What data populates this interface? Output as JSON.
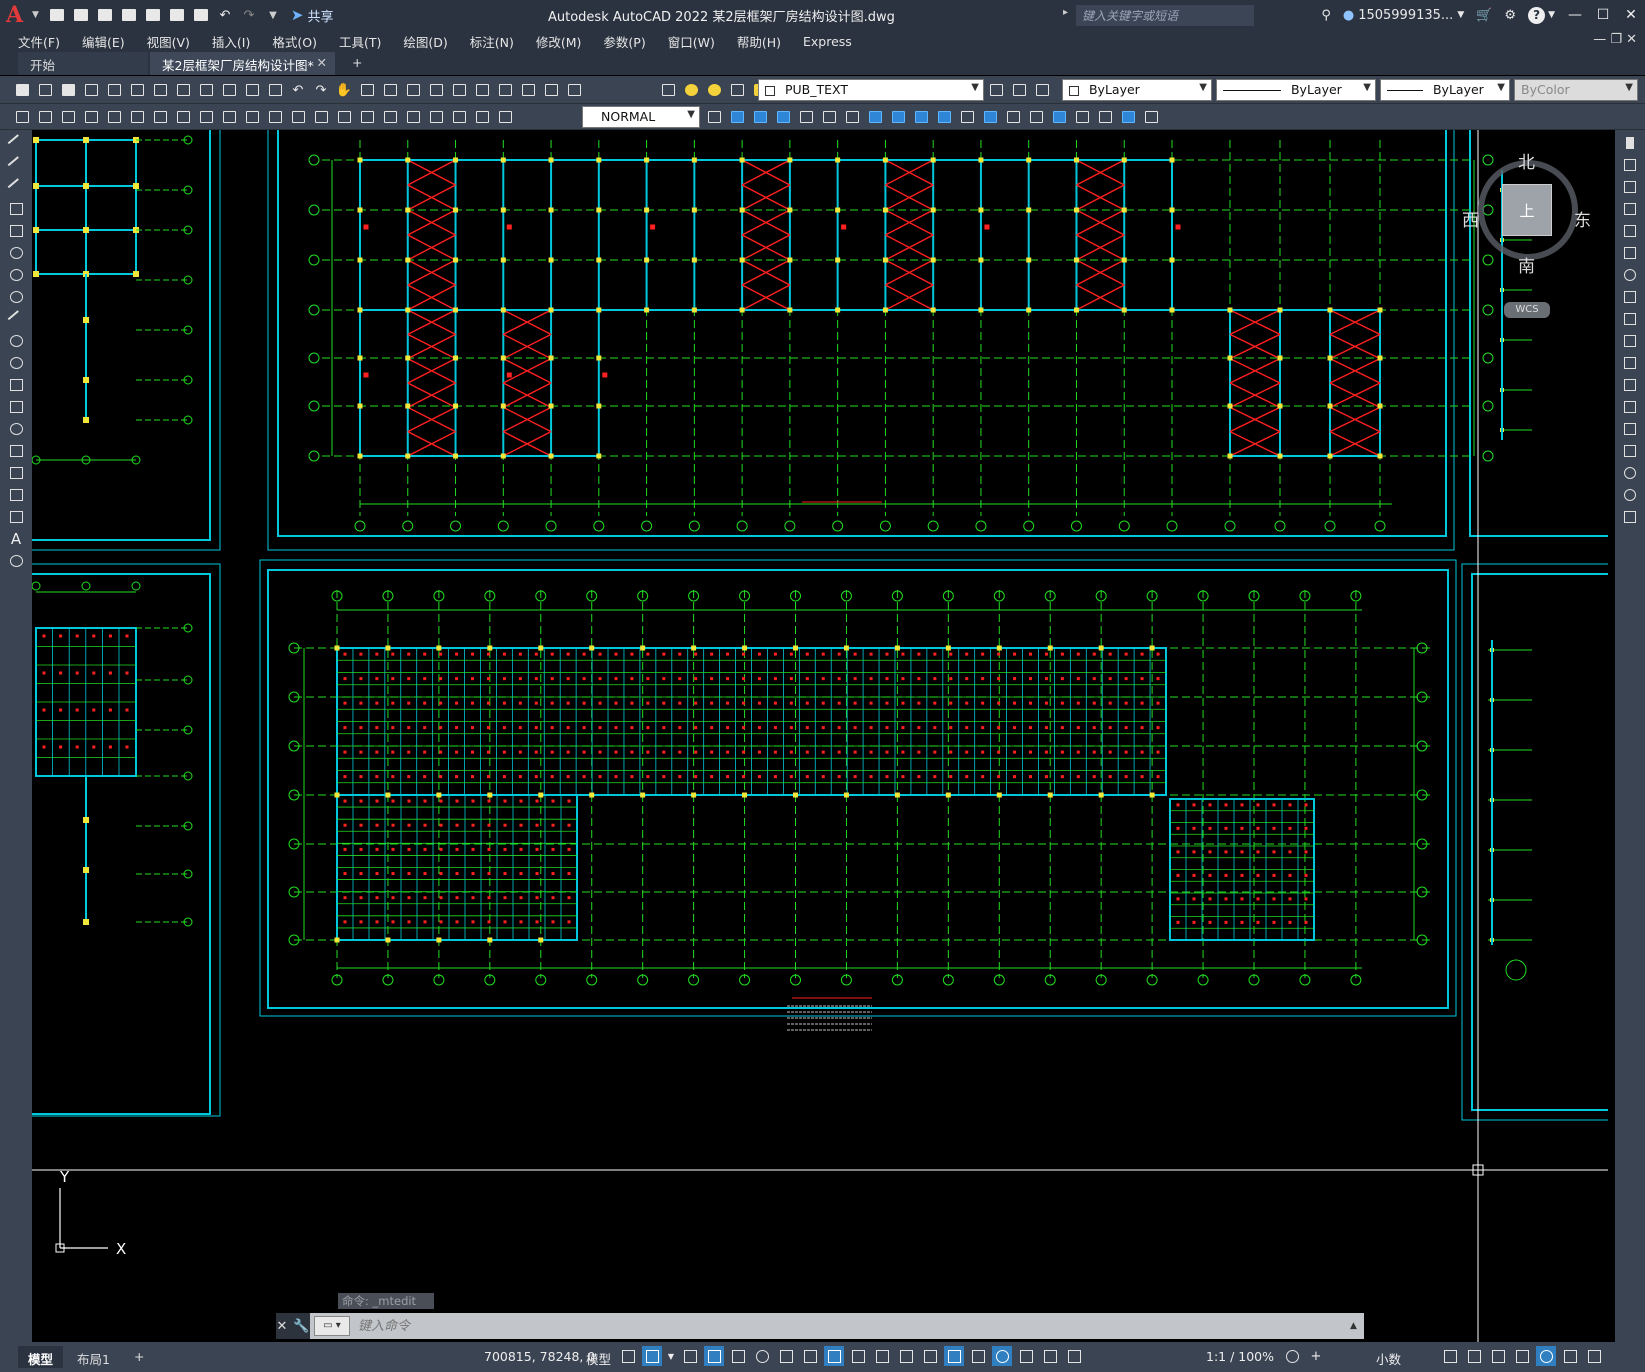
{
  "titlebar": {
    "logo": "A",
    "share_label": "共享",
    "app_title": "Autodesk AutoCAD 2022    某2层框架厂房结构设计图.dwg",
    "search_placeholder": "键入关键字或短语",
    "user": "1505999135...",
    "help": "?"
  },
  "menu": {
    "items": [
      "文件(F)",
      "编辑(E)",
      "视图(V)",
      "插入(I)",
      "格式(O)",
      "工具(T)",
      "绘图(D)",
      "标注(N)",
      "修改(M)",
      "参数(P)",
      "窗口(W)",
      "帮助(H)",
      "Express"
    ]
  },
  "tabs": {
    "start": "开始",
    "document": "某2层框架厂房结构设计图*",
    "add": "+"
  },
  "toolbar": {
    "layer": "PUB_TEXT",
    "color": "ByLayer",
    "linetype": "ByLayer",
    "lineweight": "ByLayer",
    "plotstyle": "ByColor",
    "textstyle": "NORMAL"
  },
  "viewcube": {
    "north": "北",
    "south": "南",
    "east": "东",
    "west": "西",
    "face": "上",
    "wcs": "WCS"
  },
  "ucs": {
    "x_label": "X",
    "y_label": "Y"
  },
  "command": {
    "history": "命令: _mtedit",
    "placeholder": "键入命令"
  },
  "status": {
    "tab_model": "模型",
    "tab_layout": "布局1",
    "tab_add": "+",
    "coords": "700815, 78248, 0",
    "space": "模型",
    "scale": "1:1 / 100%",
    "units": "小数"
  },
  "colors": {
    "frame": "#00c8dc",
    "grid": "#22dd22",
    "bracing": "#ff2020",
    "column": "#f2e63a",
    "ui_bg": "#3b4453"
  }
}
